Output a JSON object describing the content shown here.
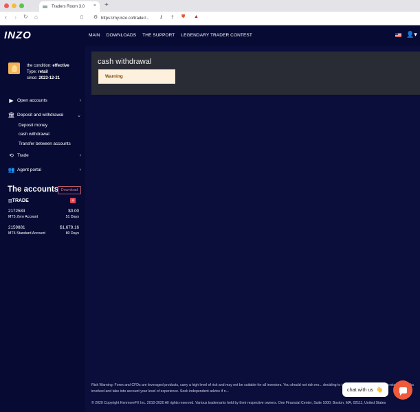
{
  "browser": {
    "tab_title": "Traders Room 3.0",
    "tab_close": "×",
    "new_tab": "+",
    "url": "https://my.inzo.co/trader/..."
  },
  "nav": {
    "logo": "INZO",
    "menu": [
      "MAIN",
      "DOWNLOADS",
      "THE SUPPORT",
      "LEGENDARY TRADER CONTEST"
    ]
  },
  "profile": {
    "condition_label": "the condition:",
    "condition_value": "effective",
    "type_label": "Type:",
    "type_value": "retail",
    "since_label": "since:",
    "since_value": "2023-12-21"
  },
  "sidebar": {
    "open_accounts": "Open accounts",
    "deposit_withdrawal": "Deposit and withdrawal",
    "sub_items": [
      "Deposit money",
      "cash withdrawal",
      "Transfer between accounts"
    ],
    "trade": "Trade",
    "agent_portal": "Agent portal"
  },
  "accounts": {
    "title": "The accounts",
    "download": "Download",
    "group": "TRADE",
    "plus": "+",
    "list": [
      {
        "number": "2172583",
        "balance": "$0.00",
        "type": "MT5 Zero Account",
        "age": "51 Days"
      },
      {
        "number": "2159881",
        "balance": "$1,679.16",
        "type": "MT5 Standard Account",
        "age": "80 Days"
      }
    ]
  },
  "main": {
    "title": "cash withdrawal",
    "warning": "Warning"
  },
  "footer": {
    "risk": "Risk Warning: Forex and CFDs are leveraged products, carry a high level of risk and may not be suitable for all investors. You should not risk mo... deciding to trade, please ensure you understand the risks involved and take into account your level of experience. Seek independent advice if n...",
    "copyright": "© 2020 Copyright KenmoreFX Inc. 2010-2020 All rights reserved. Various trademarks held by their respective owners. One Financial Center, Suite 1000, Boston, MA, 02111, United States"
  },
  "chat": {
    "label": "chat with us",
    "emoji": "👋"
  },
  "colors": {
    "background": "#0b0e3a",
    "panel": "#2a2c35",
    "warning_bg": "#fdf0dc",
    "accent": "#f05a3a"
  }
}
